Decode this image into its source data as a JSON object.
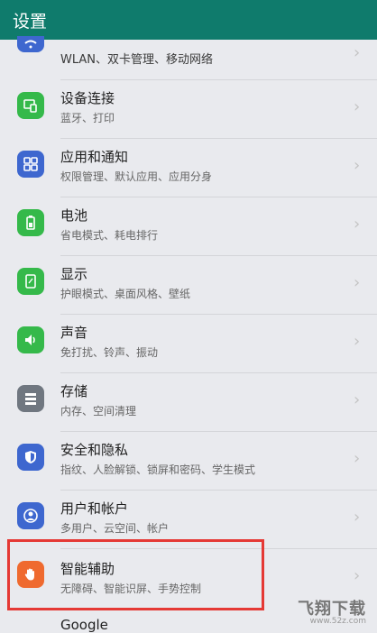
{
  "header": {
    "title": "设置"
  },
  "top_partial_subtitle": "WLAN、双卡管理、移动网络",
  "items": [
    {
      "title": "设备连接",
      "subtitle": "蓝牙、打印",
      "icon": "device-connection-icon",
      "color": "#35b94a"
    },
    {
      "title": "应用和通知",
      "subtitle": "权限管理、默认应用、应用分身",
      "icon": "apps-grid-icon",
      "color": "#3e67cf"
    },
    {
      "title": "电池",
      "subtitle": "省电模式、耗电排行",
      "icon": "battery-icon",
      "color": "#35b94a"
    },
    {
      "title": "显示",
      "subtitle": "护眼模式、桌面风格、壁纸",
      "icon": "display-icon",
      "color": "#35b94a"
    },
    {
      "title": "声音",
      "subtitle": "免打扰、铃声、振动",
      "icon": "speaker-icon",
      "color": "#35b94a"
    },
    {
      "title": "存储",
      "subtitle": "内存、空间清理",
      "icon": "storage-icon",
      "color": "#707780"
    },
    {
      "title": "安全和隐私",
      "subtitle": "指纹、人脸解锁、锁屏和密码、学生模式",
      "icon": "shield-icon",
      "color": "#3e67cf"
    },
    {
      "title": "用户和帐户",
      "subtitle": "多用户、云空间、帐户",
      "icon": "user-icon",
      "color": "#3e67cf"
    },
    {
      "title": "智能辅助",
      "subtitle": "无障碍、智能识屏、手势控制",
      "icon": "hand-icon",
      "color": "#ef6a2f"
    }
  ],
  "bottom_partial_title": "Google",
  "watermark": {
    "main": "飞翔下载",
    "sub": "www.52z.com"
  }
}
